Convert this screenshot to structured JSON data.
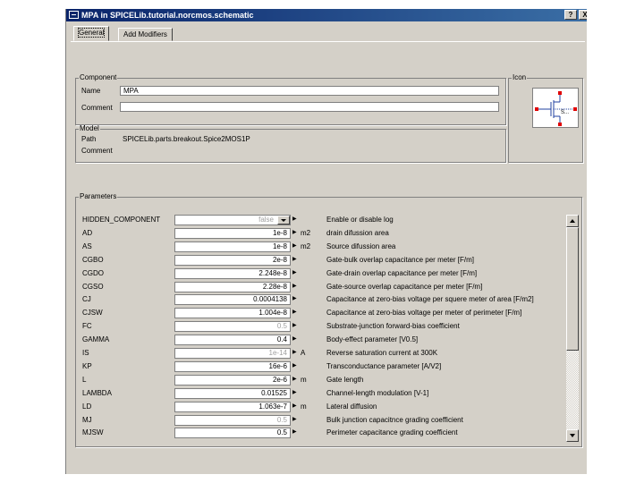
{
  "window": {
    "title": "MPA in SPICELib.tutorial.norcmos.schematic",
    "help_label": "?",
    "close_label": "X"
  },
  "tabs": [
    {
      "label": "General",
      "active": true
    },
    {
      "label": "Add Modifiers",
      "active": false
    }
  ],
  "component": {
    "legend": "Component",
    "name_label": "Name",
    "name_value": "MPA",
    "comment_label": "Comment",
    "comment_value": ""
  },
  "icon_panel": {
    "legend": "Icon",
    "symbol_text": "S..."
  },
  "model": {
    "legend": "Model",
    "path_label": "Path",
    "path_value": "SPICELib.parts.breakout.Spice2MOS1P",
    "comment_label": "Comment"
  },
  "parameters": {
    "legend": "Parameters",
    "rows": [
      {
        "name": "HIDDEN_COMPONENT",
        "value": "false",
        "unit": "",
        "desc": "Enable or disable log",
        "dim": true,
        "dropdown": true
      },
      {
        "name": "AD",
        "value": "1e-8",
        "unit": "m2",
        "desc": "drain difussion area",
        "dim": false,
        "dropdown": false
      },
      {
        "name": "AS",
        "value": "1e-8",
        "unit": "m2",
        "desc": "Source difussion area",
        "dim": false,
        "dropdown": false
      },
      {
        "name": "CGBO",
        "value": "2e-8",
        "unit": "",
        "desc": "Gate-bulk overlap capacitance per meter [F/m]",
        "dim": false,
        "dropdown": false
      },
      {
        "name": "CGDO",
        "value": "2.248e-8",
        "unit": "",
        "desc": "Gate-drain overlap capacitance per meter [F/m]",
        "dim": false,
        "dropdown": false
      },
      {
        "name": "CGSO",
        "value": "2.28e-8",
        "unit": "",
        "desc": "Gate-source overlap capacitance per meter [F/m]",
        "dim": false,
        "dropdown": false
      },
      {
        "name": "CJ",
        "value": "0.0004138",
        "unit": "",
        "desc": "Capacitance at zero-bias voltage per squere meter of area [F/m2]",
        "dim": false,
        "dropdown": false
      },
      {
        "name": "CJSW",
        "value": "1.004e-8",
        "unit": "",
        "desc": "Capacitance at zero-bias voltage per meter of perimeter [F/m]",
        "dim": false,
        "dropdown": false
      },
      {
        "name": "FC",
        "value": "0.5",
        "unit": "",
        "desc": "Substrate-junction forward-bias coefficient",
        "dim": true,
        "dropdown": false
      },
      {
        "name": "GAMMA",
        "value": "0.4",
        "unit": "",
        "desc": "Body-effect parameter [V0.5]",
        "dim": false,
        "dropdown": false
      },
      {
        "name": "IS",
        "value": "1e-14",
        "unit": "A",
        "desc": "Reverse saturation current at 300K",
        "dim": true,
        "dropdown": false
      },
      {
        "name": "KP",
        "value": "16e-6",
        "unit": "",
        "desc": "Transconductance parameter [A/V2]",
        "dim": false,
        "dropdown": false
      },
      {
        "name": "L",
        "value": "2e-6",
        "unit": "m",
        "desc": "Gate length",
        "dim": false,
        "dropdown": false
      },
      {
        "name": "LAMBDA",
        "value": "0.01525",
        "unit": "",
        "desc": "Channel-length modulation [V-1]",
        "dim": false,
        "dropdown": false
      },
      {
        "name": "LD",
        "value": "1.063e-7",
        "unit": "m",
        "desc": "Lateral diffusion",
        "dim": false,
        "dropdown": false
      },
      {
        "name": "MJ",
        "value": "0.5",
        "unit": "",
        "desc": "Bulk junction capacitnce grading coefficient",
        "dim": true,
        "dropdown": false
      },
      {
        "name": "MJSW",
        "value": "0.5",
        "unit": "",
        "desc": "Perimeter capacitance grading coefficient",
        "dim": false,
        "dropdown": false
      }
    ]
  },
  "colors": {
    "titlebar_start": "#0a246a",
    "titlebar_end": "#3a6ea5",
    "dialog_bg": "#d4d0c8",
    "pin_marker": "#e00000",
    "symbol_stroke": "#2040a0"
  },
  "icons": {
    "title_icon": "window-icon",
    "row_arrow": "triangle-right-icon",
    "component_symbol": "mosfet-symbol-icon"
  }
}
